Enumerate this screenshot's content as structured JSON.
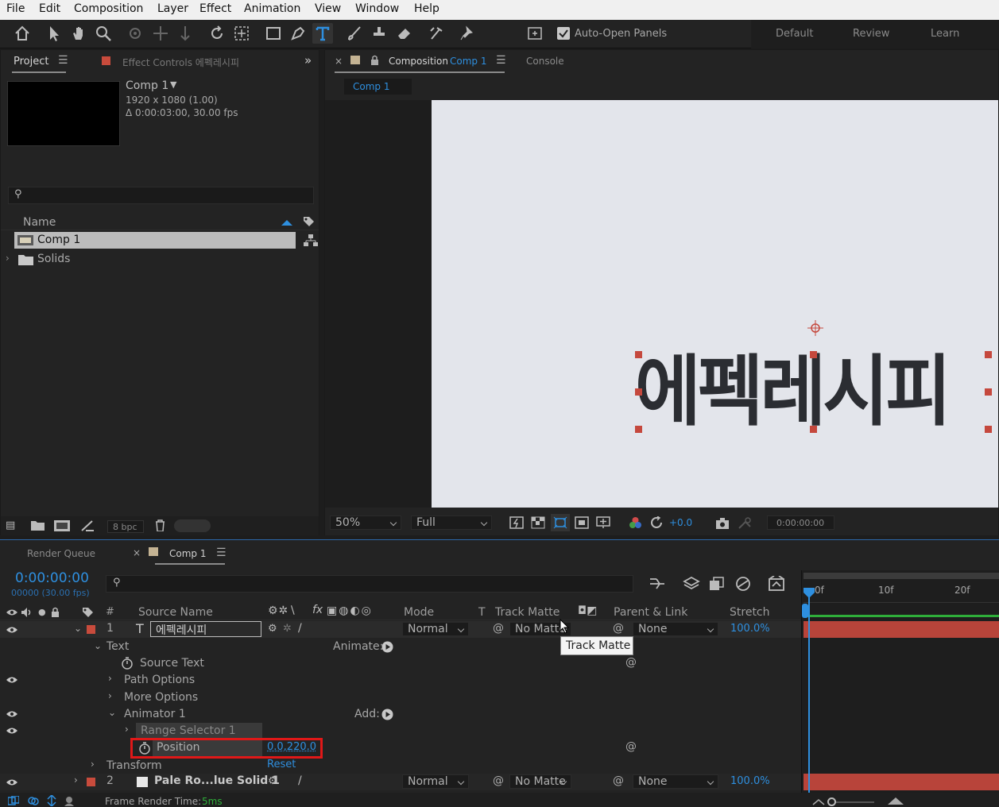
{
  "menu": [
    "File",
    "Edit",
    "Composition",
    "Layer",
    "Effect",
    "Animation",
    "View",
    "Window",
    "Help"
  ],
  "toolbar": {
    "auto_open_label": "Auto-Open Panels",
    "workspaces": [
      "Default",
      "Review",
      "Learn"
    ]
  },
  "project_panel": {
    "tab_project": "Project",
    "tab_effect_controls": "Effect Controls 에펙레시피",
    "comp_name": "Comp 1",
    "comp_size": "1920 x 1080 (1.00)",
    "comp_duration": "Δ 0:00:03:00, 30.00 fps",
    "search_placeholder": "",
    "col_name": "Name",
    "items": [
      {
        "label": "Comp 1",
        "type": "comp"
      },
      {
        "label": "Solids",
        "type": "folder"
      }
    ],
    "bpc": "8 bpc"
  },
  "composition_panel": {
    "tab_label": "Composition",
    "tab_comp": "Comp 1",
    "tab_console": "Console",
    "subtab": "Comp 1",
    "canvas_text": "에펙레시피",
    "zoom": "50%",
    "resolution": "Full",
    "exposure": "+0.0",
    "timecode": "0:00:00:00"
  },
  "timeline": {
    "tab_render_queue": "Render Queue",
    "tab_comp": "Comp 1",
    "timecode": "0:00:00:00",
    "frames": "00000 (30.00 fps)",
    "columns": {
      "num": "#",
      "source_name": "Source Name",
      "mode": "Mode",
      "t": "T",
      "track_matte": "Track Matte",
      "parent_link": "Parent & Link",
      "stretch": "Stretch"
    },
    "ruler": [
      "0f",
      "10f",
      "20f"
    ],
    "layer1": {
      "num": "1",
      "name": "에펙레시피",
      "mode": "Normal",
      "matte": "No Matte",
      "parent": "None",
      "stretch": "100.0%"
    },
    "props": {
      "text": "Text",
      "animate": "Animate:",
      "source_text": "Source Text",
      "path_options": "Path Options",
      "more_options": "More Options",
      "animator": "Animator 1",
      "add": "Add:",
      "range_selector": "Range Selector 1",
      "position": "Position",
      "position_value": "0.0,220.0",
      "transform": "Transform",
      "reset": "Reset"
    },
    "tooltip": "Track Matte",
    "layer2": {
      "num": "2",
      "name": "Pale Ro...lue Solid 1",
      "mode": "Normal",
      "matte": "No Matte",
      "parent": "None",
      "stretch": "100.0%"
    },
    "footer_label": "Frame Render Time:",
    "footer_value": "5ms"
  },
  "colors": {
    "accent": "#2e8fdf",
    "label_red": "#c84b3c",
    "highlight_red": "#e01818",
    "canvas_bg": "#e3e5eb",
    "canvas_text": "#2b2d32"
  }
}
